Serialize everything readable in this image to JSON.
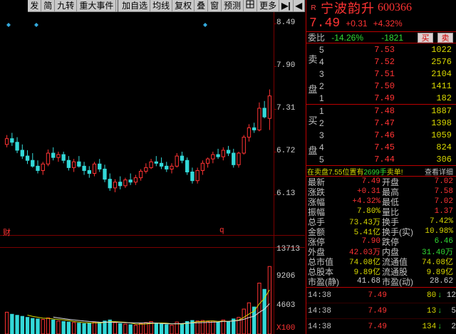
{
  "toolbar": {
    "items": [
      "发",
      "简",
      "九转",
      "重大事件",
      "加自选",
      "均线",
      "复权",
      "叠",
      "窗",
      "预测",
      "",
      "更多"
    ],
    "arrow": "▶|",
    "close": "◀"
  },
  "chart": {
    "price_ticks": [
      "8.49",
      "7.90",
      "7.31",
      "6.72",
      "6.13"
    ],
    "volume_ticks": [
      "13713",
      "9206",
      "4603"
    ],
    "volume_unit": "X100",
    "marker_cai": "财",
    "marker_q": "q"
  },
  "chart_data": {
    "type": "candlestick",
    "price_ylim": [
      6.13,
      8.49
    ],
    "volume_ylim": [
      0,
      13713
    ],
    "candles": [
      [
        6.82,
        6.95,
        6.78,
        6.9,
        4200
      ],
      [
        6.9,
        6.98,
        6.8,
        6.85,
        3800
      ],
      [
        6.85,
        6.92,
        6.7,
        6.74,
        3600
      ],
      [
        6.74,
        6.82,
        6.62,
        6.66,
        3400
      ],
      [
        6.66,
        6.74,
        6.55,
        6.6,
        3200
      ],
      [
        6.6,
        6.7,
        6.5,
        6.52,
        3000
      ],
      [
        6.52,
        6.6,
        6.42,
        6.46,
        2900
      ],
      [
        6.46,
        6.58,
        6.4,
        6.55,
        2800
      ],
      [
        6.55,
        6.75,
        6.52,
        6.7,
        3100
      ],
      [
        6.7,
        6.78,
        6.6,
        6.64,
        2700
      ],
      [
        6.64,
        6.72,
        6.58,
        6.68,
        2500
      ],
      [
        6.68,
        6.72,
        6.56,
        6.6,
        2400
      ],
      [
        6.6,
        6.66,
        6.46,
        6.5,
        2300
      ],
      [
        6.5,
        6.62,
        6.44,
        6.58,
        2200
      ],
      [
        6.58,
        6.66,
        6.5,
        6.52,
        2100
      ],
      [
        6.52,
        6.58,
        6.4,
        6.46,
        2000
      ],
      [
        6.46,
        6.52,
        6.36,
        6.42,
        2100
      ],
      [
        6.42,
        6.58,
        6.38,
        6.55,
        2300
      ],
      [
        6.55,
        6.62,
        6.44,
        6.48,
        2200
      ],
      [
        6.48,
        6.54,
        6.3,
        6.34,
        2500
      ],
      [
        6.34,
        6.42,
        6.18,
        6.22,
        2700
      ],
      [
        6.22,
        6.34,
        6.16,
        6.3,
        2200
      ],
      [
        6.3,
        6.38,
        6.2,
        6.25,
        2000
      ],
      [
        6.25,
        6.36,
        6.22,
        6.33,
        1900
      ],
      [
        6.33,
        6.42,
        6.26,
        6.3,
        1800
      ],
      [
        6.3,
        6.4,
        6.26,
        6.36,
        1700
      ],
      [
        6.36,
        6.48,
        6.32,
        6.45,
        2000
      ],
      [
        6.45,
        6.56,
        6.42,
        6.5,
        2200
      ],
      [
        6.5,
        6.62,
        6.48,
        6.58,
        2400
      ],
      [
        6.58,
        6.66,
        6.52,
        6.56,
        2100
      ],
      [
        6.56,
        6.64,
        6.48,
        6.52,
        1900
      ],
      [
        6.52,
        6.58,
        6.44,
        6.48,
        1800
      ],
      [
        6.48,
        6.56,
        6.42,
        6.52,
        1700
      ],
      [
        6.52,
        6.7,
        6.5,
        6.66,
        2300
      ],
      [
        6.66,
        6.72,
        6.56,
        6.6,
        2000
      ],
      [
        6.6,
        6.64,
        6.4,
        6.44,
        2400
      ],
      [
        6.44,
        6.5,
        6.28,
        6.32,
        2600
      ],
      [
        6.32,
        6.5,
        6.28,
        6.46,
        2500
      ],
      [
        6.46,
        6.6,
        6.4,
        6.56,
        2600
      ],
      [
        6.56,
        6.64,
        6.5,
        6.62,
        2400
      ],
      [
        6.62,
        6.72,
        6.56,
        6.68,
        2500
      ],
      [
        6.68,
        6.76,
        6.62,
        6.65,
        2200
      ],
      [
        6.65,
        6.78,
        6.6,
        6.74,
        2700
      ],
      [
        6.74,
        6.8,
        6.66,
        6.7,
        2400
      ],
      [
        6.7,
        6.76,
        6.5,
        6.54,
        2900
      ],
      [
        6.54,
        6.72,
        6.5,
        6.7,
        3200
      ],
      [
        6.7,
        6.95,
        6.68,
        6.92,
        4800
      ],
      [
        6.92,
        7.1,
        6.86,
        7.05,
        6000
      ],
      [
        7.05,
        7.12,
        6.98,
        7.02,
        5200
      ],
      [
        7.02,
        7.4,
        7.0,
        7.32,
        9800
      ],
      [
        7.32,
        7.42,
        7.18,
        7.2,
        8600
      ],
      [
        7.18,
        7.58,
        7.02,
        7.49,
        13000
      ]
    ]
  },
  "header": {
    "badge": "R",
    "name": "宁波韵升",
    "code": "600366",
    "price": "7.49",
    "change": "+0.31",
    "change_pct": "+4.32%"
  },
  "weibi": {
    "label": "委比",
    "ratio": "-14.26%",
    "diff": "-1821",
    "buy_btn": "买",
    "sell_btn": "卖"
  },
  "sell_book": {
    "side": [
      "卖",
      "盘"
    ],
    "rows": [
      {
        "lvl": "5",
        "price": "7.53",
        "vol": "1022"
      },
      {
        "lvl": "4",
        "price": "7.52",
        "vol": "2576"
      },
      {
        "lvl": "3",
        "price": "7.51",
        "vol": "2104"
      },
      {
        "lvl": "2",
        "price": "7.50",
        "vol": "1411"
      },
      {
        "lvl": "1",
        "price": "7.49",
        "vol": "182"
      }
    ]
  },
  "buy_book": {
    "side": [
      "买",
      "盘"
    ],
    "rows": [
      {
        "lvl": "1",
        "price": "7.48",
        "vol": "1887"
      },
      {
        "lvl": "2",
        "price": "7.47",
        "vol": "1398"
      },
      {
        "lvl": "3",
        "price": "7.46",
        "vol": "1059"
      },
      {
        "lvl": "4",
        "price": "7.45",
        "vol": "824"
      },
      {
        "lvl": "5",
        "price": "7.44",
        "vol": "306"
      }
    ]
  },
  "notice": {
    "a": "在卖盘7.55位置有",
    "b": "2699手",
    "c": "卖单!",
    "link": "查看详细"
  },
  "stats": [
    {
      "l1": "最新",
      "v1": "7.49",
      "c1": "",
      "l2": "开盘",
      "v2": "7.02",
      "c2": ""
    },
    {
      "l1": "涨跌",
      "v1": "+0.31",
      "c1": "",
      "l2": "最高",
      "v2": "7.58",
      "c2": ""
    },
    {
      "l1": "涨幅",
      "v1": "+4.32%",
      "c1": "",
      "l2": "最低",
      "v2": "7.02",
      "c2": ""
    },
    {
      "l1": "振幅",
      "v1": "7.80%",
      "c1": "y",
      "l2": "量比",
      "v2": "1.37",
      "c2": ""
    },
    {
      "l1": "总手",
      "v1": "73.43万",
      "c1": "y",
      "l2": "换手",
      "v2": "7.42%",
      "c2": "y"
    },
    {
      "l1": "金额",
      "v1": "5.41亿",
      "c1": "y",
      "l2": "换手(实)",
      "v2": "10.98%",
      "c2": "y"
    },
    {
      "l1": "涨停",
      "v1": "7.90",
      "c1": "",
      "l2": "跌停",
      "v2": "6.46",
      "c2": "g"
    },
    {
      "l1": "外盘",
      "v1": "42.03万",
      "c1": "",
      "l2": "内盘",
      "v2": "31.40万",
      "c2": "g"
    },
    {
      "l1": "总市值",
      "v1": "74.08亿",
      "c1": "y",
      "l2": "流通值",
      "v2": "74.08亿",
      "c2": "y"
    },
    {
      "l1": "总股本",
      "v1": "9.89亿",
      "c1": "y",
      "l2": "流通股",
      "v2": "9.89亿",
      "c2": "y"
    },
    {
      "l1": "市盈(静)",
      "v1": "41.68",
      "c1": "w",
      "l2": "市盈(动)",
      "v2": "28.62",
      "c2": "w"
    }
  ],
  "ticks": [
    {
      "time": "14:38",
      "price": "7.49",
      "vol": "80",
      "dir": "↓",
      "cnt": "12"
    },
    {
      "time": "14:38",
      "price": "7.49",
      "vol": "13",
      "dir": "↓",
      "cnt": "5"
    },
    {
      "time": "14:38",
      "price": "7.49",
      "vol": "134",
      "dir": "↓",
      "cnt": "2"
    }
  ],
  "colors": {
    "up": "#ff3333",
    "down": "#33d8d8",
    "ma": "#d8d800",
    "grid": "#7a0000",
    "marker": "#33aadd"
  }
}
